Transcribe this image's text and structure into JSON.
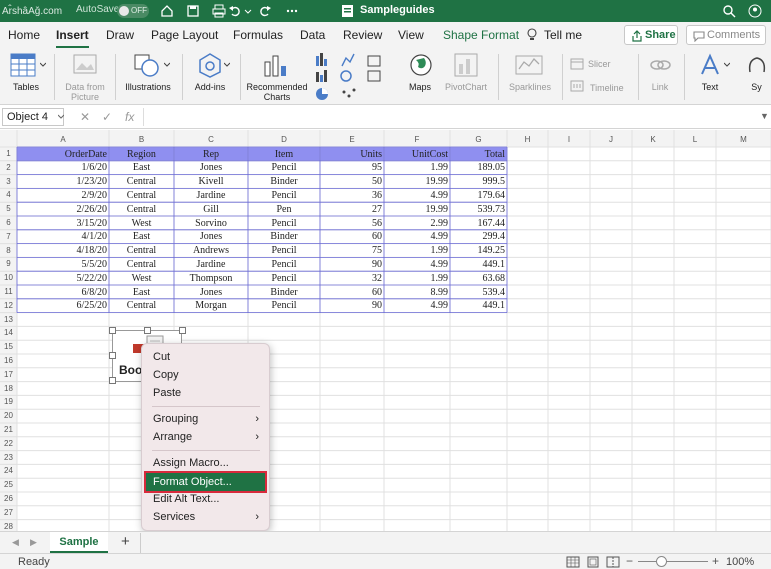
{
  "watermark": "Ar̂shâAğ.com",
  "titlebar": {
    "autosave_label": "AutoSave",
    "autosave_state": "OFF",
    "title": "Sampleguides"
  },
  "tabs": [
    "Home",
    "Insert",
    "Draw",
    "Page Layout",
    "Formulas",
    "Data",
    "Review",
    "View",
    "Shape Format"
  ],
  "tell_me": "Tell me",
  "share_label": "Share",
  "comments_label": "Comments",
  "ribbon": {
    "tables": "Tables",
    "data_from_picture_1": "Data from",
    "data_from_picture_2": "Picture",
    "illustrations": "Illustrations",
    "addins": "Add-ins",
    "recommended_1": "Recommended",
    "recommended_2": "Charts",
    "maps": "Maps",
    "pivotchart": "PivotChart",
    "sparklines": "Sparklines",
    "slicer": "Slicer",
    "timeline": "Timeline",
    "link": "Link",
    "text": "Text",
    "sy": "Sy"
  },
  "formula_bar": {
    "name_box": "Object 4",
    "fx": "fx"
  },
  "columns": [
    "A",
    "B",
    "C",
    "D",
    "E",
    "F",
    "G",
    "H",
    "I",
    "J",
    "K",
    "L",
    "M"
  ],
  "rows": [
    "1",
    "2",
    "3",
    "4",
    "5",
    "6",
    "7",
    "8",
    "9",
    "10",
    "11",
    "12",
    "13",
    "14",
    "15",
    "16",
    "17",
    "18",
    "19",
    "20",
    "21",
    "22",
    "23",
    "24",
    "25",
    "26",
    "27",
    "28",
    "29"
  ],
  "table": {
    "headers": [
      "OrderDate",
      "Region",
      "Rep",
      "Item",
      "Units",
      "UnitCost",
      "Total"
    ],
    "rows": [
      [
        "1/6/20",
        "East",
        "Jones",
        "Pencil",
        "95",
        "1.99",
        "189.05"
      ],
      [
        "1/23/20",
        "Central",
        "Kivell",
        "Binder",
        "50",
        "19.99",
        "999.5"
      ],
      [
        "2/9/20",
        "Central",
        "Jardine",
        "Pencil",
        "36",
        "4.99",
        "179.64"
      ],
      [
        "2/26/20",
        "Central",
        "Gill",
        "Pen",
        "27",
        "19.99",
        "539.73"
      ],
      [
        "3/15/20",
        "West",
        "Sorvino",
        "Pencil",
        "56",
        "2.99",
        "167.44"
      ],
      [
        "4/1/20",
        "East",
        "Jones",
        "Binder",
        "60",
        "4.99",
        "299.4"
      ],
      [
        "4/18/20",
        "Central",
        "Andrews",
        "Pencil",
        "75",
        "1.99",
        "149.25"
      ],
      [
        "5/5/20",
        "Central",
        "Jardine",
        "Pencil",
        "90",
        "4.99",
        "449.1"
      ],
      [
        "5/22/20",
        "West",
        "Thompson",
        "Pencil",
        "32",
        "1.99",
        "63.68"
      ],
      [
        "6/8/20",
        "East",
        "Jones",
        "Binder",
        "60",
        "8.99",
        "539.4"
      ],
      [
        "6/25/20",
        "Central",
        "Morgan",
        "Pencil",
        "90",
        "4.99",
        "449.1"
      ]
    ]
  },
  "object_label": "Boo",
  "context_menu": {
    "cut": "Cut",
    "copy": "Copy",
    "paste": "Paste",
    "grouping": "Grouping",
    "arrange": "Arrange",
    "assign_macro": "Assign Macro...",
    "format_object": "Format Object...",
    "edit_alt_text": "Edit Alt Text...",
    "services": "Services"
  },
  "sheet_tab": "Sample",
  "add_sheet": "+",
  "status": {
    "ready": "Ready",
    "zoom": "100%"
  },
  "colors": {
    "brand": "#1f7244",
    "header_fill": "#8f8ff0",
    "table_border": "#6b6bd8",
    "menu_highlight_outline": "#d82a3c"
  }
}
